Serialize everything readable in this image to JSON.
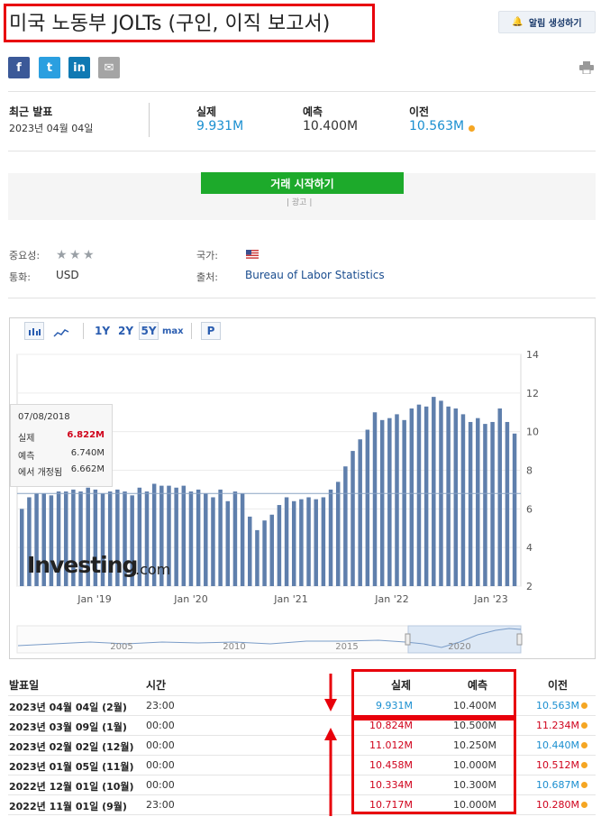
{
  "header": {
    "title": "미국 노동부 JOLTs (구인, 이직 보고서)",
    "alert_label": "알림 생성하기"
  },
  "share": {
    "facebook": "f",
    "twitter": "t",
    "linkedin": "in",
    "email": "✉",
    "print_icon": "print-icon"
  },
  "latest": {
    "release_label": "최근 발표",
    "release_date": "2023년 04월 04일",
    "actual_label": "실제",
    "actual_value": "9.931M",
    "forecast_label": "예측",
    "forecast_value": "10.400M",
    "previous_label": "이전",
    "previous_value": "10.563M"
  },
  "ad": {
    "trade_button": "거래 시작하기",
    "ad_label": "| 광고 |"
  },
  "meta": {
    "importance_label": "중요성:",
    "importance_stars": 3,
    "country_label": "국가:",
    "currency_label": "통화:",
    "currency_value": "USD",
    "source_label": "출처:",
    "source_value": "Bureau of Labor Statistics"
  },
  "toolbar": {
    "bar_icon": "bar-chart-icon",
    "line_icon": "line-chart-icon",
    "range_1y": "1Y",
    "range_2y": "2Y",
    "range_5y": "5Y",
    "range_max": "max",
    "p_button": "P"
  },
  "tooltip": {
    "date": "07/08/2018",
    "actual_label": "실제",
    "actual_value": "6.822M",
    "forecast_label": "예측",
    "forecast_value": "6.740M",
    "revised_label": "에서 개정됨",
    "revised_value": "6.662M"
  },
  "logo": {
    "text": "Investing",
    "suffix": ".com"
  },
  "chart_data": {
    "type": "bar",
    "ylim": [
      2,
      14
    ],
    "y_ticks": [
      "2",
      "4",
      "6",
      "8",
      "10",
      "12",
      "14"
    ],
    "x_tick_labels": [
      "Jan '19",
      "Jan '20",
      "Jan '21",
      "Jan '22",
      "Jan '23"
    ],
    "navigator_labels": [
      "2005",
      "2010",
      "2015",
      "2020"
    ],
    "reference_line": 6.8,
    "values": [
      6.0,
      6.6,
      6.8,
      6.8,
      6.7,
      6.9,
      6.9,
      7.0,
      6.9,
      7.1,
      7.0,
      6.8,
      6.9,
      7.0,
      6.9,
      6.7,
      7.1,
      6.9,
      7.3,
      7.2,
      7.2,
      7.1,
      7.2,
      6.9,
      7.0,
      6.8,
      6.6,
      7.0,
      6.4,
      6.9,
      6.8,
      5.6,
      4.9,
      5.4,
      5.7,
      6.2,
      6.6,
      6.4,
      6.5,
      6.6,
      6.5,
      6.6,
      7.0,
      7.4,
      8.2,
      9.0,
      9.6,
      10.1,
      11.0,
      10.6,
      10.7,
      10.9,
      10.6,
      11.2,
      11.4,
      11.3,
      11.8,
      11.6,
      11.3,
      11.2,
      10.9,
      10.5,
      10.7,
      10.4,
      10.5,
      11.2,
      10.5,
      9.9
    ]
  },
  "table": {
    "headers": {
      "date": "발표일",
      "time": "시간",
      "actual": "실제",
      "forecast": "예측",
      "previous": "이전"
    },
    "rows": [
      {
        "date": "2023년 04월 04일 (2월)",
        "time": "23:00",
        "actual": "9.931M",
        "forecast": "10.400M",
        "previous": "10.563M"
      },
      {
        "date": "2023년 03월 09일 (1월)",
        "time": "00:00",
        "actual": "10.824M",
        "forecast": "10.500M",
        "previous": "11.234M"
      },
      {
        "date": "2023년 02월 02일 (12월)",
        "time": "00:00",
        "actual": "11.012M",
        "forecast": "10.250M",
        "previous": "10.440M"
      },
      {
        "date": "2023년 01월 05일 (11월)",
        "time": "00:00",
        "actual": "10.458M",
        "forecast": "10.000M",
        "previous": "10.512M"
      },
      {
        "date": "2022년 12월 01일 (10월)",
        "time": "00:00",
        "actual": "10.334M",
        "forecast": "10.300M",
        "previous": "10.687M"
      },
      {
        "date": "2022년 11월 01일 (9월)",
        "time": "23:00",
        "actual": "10.717M",
        "forecast": "10.000M",
        "previous": "10.280M"
      }
    ]
  },
  "colors": {
    "bar": "#5f7fac",
    "up_red": "#d0021b",
    "blue": "#1a8fd0",
    "accent_green": "#1daa2b",
    "annotation_red": "#e8000b"
  }
}
